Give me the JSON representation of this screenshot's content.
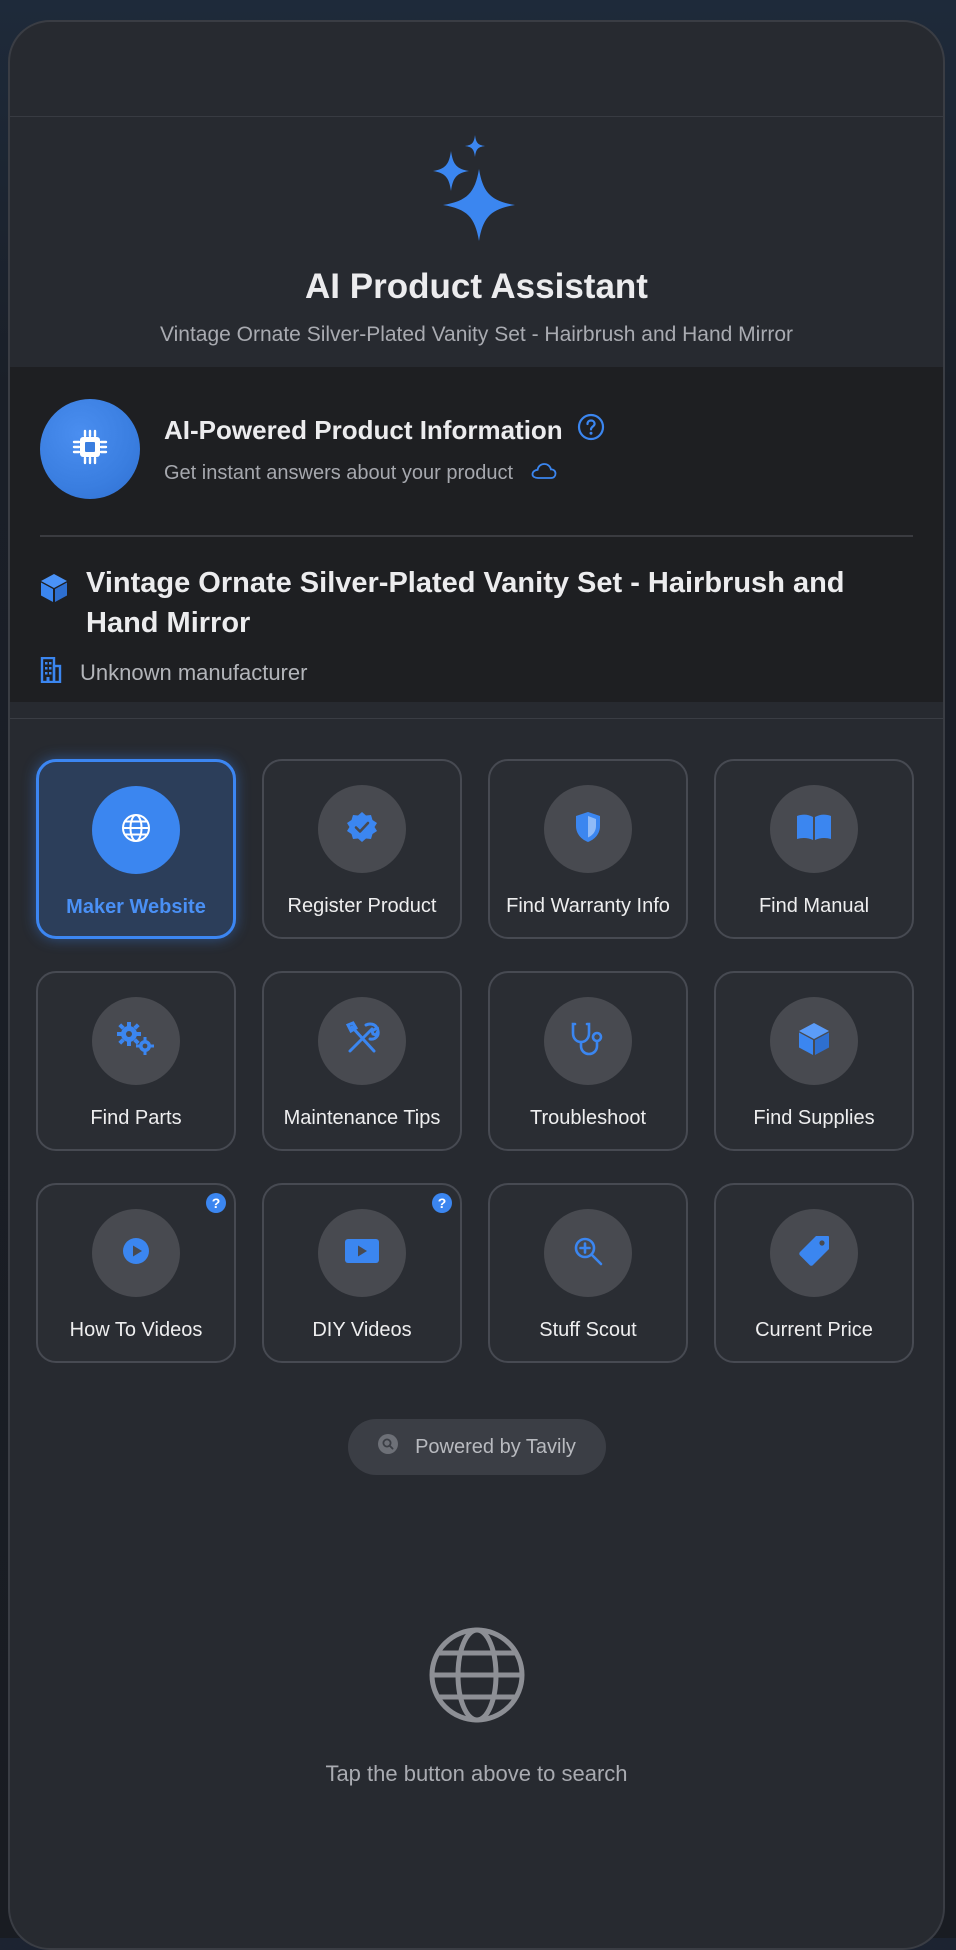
{
  "header": {
    "title": "AI Product Assistant",
    "subtitle": "Vintage Ornate Silver-Plated Vanity Set - Hairbrush and Hand Mirror"
  },
  "info_card": {
    "title": "AI-Powered Product Information",
    "subtitle": "Get instant answers about your product",
    "product_name": "Vintage Ornate Silver-Plated Vanity Set - Hairbrush and Hand Mirror",
    "manufacturer": "Unknown manufacturer"
  },
  "actions": [
    {
      "label": "Maker Website",
      "icon": "globe-icon",
      "active": true
    },
    {
      "label": "Register Product",
      "icon": "check-badge-icon"
    },
    {
      "label": "Find Warranty Info",
      "icon": "shield-icon"
    },
    {
      "label": "Find Manual",
      "icon": "book-icon"
    },
    {
      "label": "Find Parts",
      "icon": "gears-icon"
    },
    {
      "label": "Maintenance Tips",
      "icon": "tools-icon"
    },
    {
      "label": "Troubleshoot",
      "icon": "stethoscope-icon"
    },
    {
      "label": "Find Supplies",
      "icon": "box-icon"
    },
    {
      "label": "How To Videos",
      "icon": "play-circle-icon",
      "badge": "?"
    },
    {
      "label": "DIY Videos",
      "icon": "play-rectangle-icon",
      "badge": "?"
    },
    {
      "label": "Stuff Scout",
      "icon": "magnify-plus-icon"
    },
    {
      "label": "Current Price",
      "icon": "tag-icon"
    }
  ],
  "powered_by": "Powered by Tavily",
  "empty_state": {
    "icon": "globe-icon",
    "text": "Tap the button above to search"
  },
  "colors": {
    "accent": "#3b86f0",
    "sheet_background": "#272a30",
    "card_background": "#1e1f22"
  }
}
